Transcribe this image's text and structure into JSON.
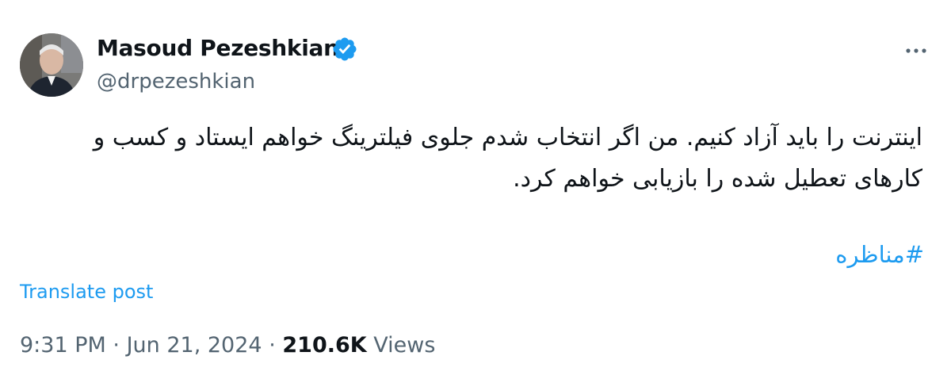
{
  "author": {
    "display_name": "Masoud Pezeshkian",
    "handle": "@drpezeshkian",
    "verified_icon": "verified-badge-icon",
    "avatar": "profile-photo"
  },
  "post": {
    "text": "اینترنت را باید آزاد کنیم. من اگر انتخاب شدم جلوی فیلترینگ خواهم ایستاد و کسب و\nکارهای تعطیل شده را بازیابی خواهم کرد.",
    "hashtag": "#مناظره",
    "translate_label": "Translate post"
  },
  "meta": {
    "time": "9:31 PM",
    "separator": "·",
    "date": "Jun 21, 2024",
    "views_count": "210.6K",
    "views_label": "Views"
  },
  "icons": {
    "more": "more-options-icon"
  },
  "colors": {
    "accent": "#1d9bf0",
    "text": "#0f1419",
    "secondary": "#536471"
  }
}
